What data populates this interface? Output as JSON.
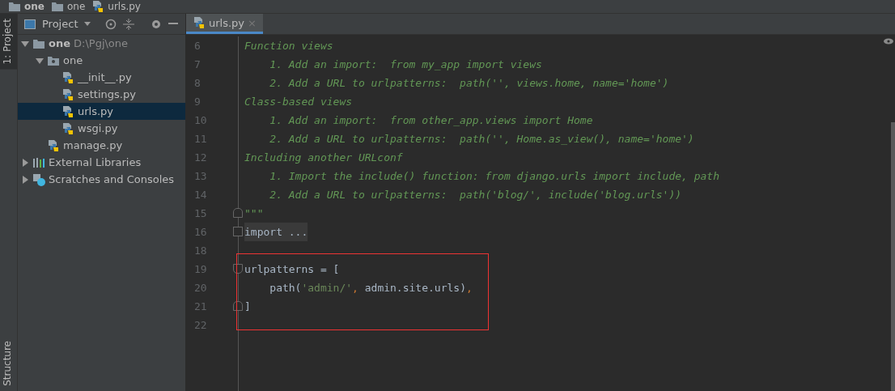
{
  "breadcrumbs": [
    {
      "label": "one",
      "kind": "folder"
    },
    {
      "label": "one",
      "kind": "folder"
    },
    {
      "label": "urls.py",
      "kind": "python"
    }
  ],
  "side_strip": {
    "top": "1: Project",
    "bottom": "Structure"
  },
  "project_panel": {
    "title": "Project"
  },
  "tree": [
    {
      "label": "one",
      "hint": "D:\\Pgj\\one",
      "kind": "root",
      "expanded": true,
      "selected": false,
      "children": [
        {
          "label": "one",
          "kind": "package",
          "expanded": true,
          "selected": false,
          "children": [
            {
              "label": "__init__.py",
              "kind": "python",
              "selected": false
            },
            {
              "label": "settings.py",
              "kind": "python",
              "selected": false
            },
            {
              "label": "urls.py",
              "kind": "python",
              "selected": true
            },
            {
              "label": "wsgi.py",
              "kind": "python",
              "selected": false
            }
          ]
        },
        {
          "label": "manage.py",
          "kind": "python",
          "selected": false
        }
      ]
    },
    {
      "label": "External Libraries",
      "kind": "libraries",
      "expanded": false,
      "selected": false
    },
    {
      "label": "Scratches and Consoles",
      "kind": "scratches",
      "expanded": false,
      "selected": false
    }
  ],
  "tabs": [
    {
      "label": "urls.py",
      "selected": true,
      "close": "×"
    }
  ],
  "code": [
    {
      "number": "6",
      "tokens": [
        {
          "text": "Function views",
          "kind": "comment"
        }
      ]
    },
    {
      "number": "7",
      "tokens": [
        {
          "text": "    1. Add an import:  from my_app import views",
          "kind": "comment"
        }
      ]
    },
    {
      "number": "8",
      "tokens": [
        {
          "text": "    2. Add a URL to urlpatterns:  path('', views.home, name='home')",
          "kind": "comment"
        }
      ]
    },
    {
      "number": "9",
      "tokens": [
        {
          "text": "Class-based views",
          "kind": "comment"
        }
      ]
    },
    {
      "number": "10",
      "tokens": [
        {
          "text": "    1. Add an import:  from other_app.views import Home",
          "kind": "comment"
        }
      ]
    },
    {
      "number": "11",
      "tokens": [
        {
          "text": "    2. Add a URL to urlpatterns:  path('', Home.as_view(), name='home')",
          "kind": "comment"
        }
      ]
    },
    {
      "number": "12",
      "tokens": [
        {
          "text": "Including another URLconf",
          "kind": "comment"
        }
      ]
    },
    {
      "number": "13",
      "tokens": [
        {
          "text": "    1. Import the include() function: from django.urls import include, path",
          "kind": "comment"
        }
      ]
    },
    {
      "number": "14",
      "tokens": [
        {
          "text": "    2. Add a URL to urlpatterns:  path('blog/', include('blog.urls'))",
          "kind": "comment"
        }
      ]
    },
    {
      "number": "15",
      "kind": "foldend",
      "tokens": [
        {
          "text": "\"\"\"",
          "kind": "comment"
        }
      ]
    },
    {
      "number": "16",
      "kind": "folded",
      "tokens": [
        {
          "text": "import ...",
          "kind": "folded"
        }
      ]
    },
    {
      "number": "18"
    },
    {
      "number": "19",
      "kind": "foldstart",
      "tokens": [
        {
          "text": "urlpatterns = [",
          "kind": "plain"
        }
      ]
    },
    {
      "number": "20",
      "tokens": [
        {
          "text": "    path(",
          "kind": "plain"
        },
        {
          "text": "'admin/'",
          "kind": "string"
        },
        {
          "text": ",",
          "kind": "punct"
        },
        {
          "text": " admin.site.urls)",
          "kind": "plain"
        },
        {
          "text": ",",
          "kind": "punct"
        }
      ]
    },
    {
      "number": "21",
      "kind": "foldend",
      "tokens": [
        {
          "text": "]",
          "kind": "plain"
        }
      ]
    },
    {
      "number": "22"
    }
  ]
}
